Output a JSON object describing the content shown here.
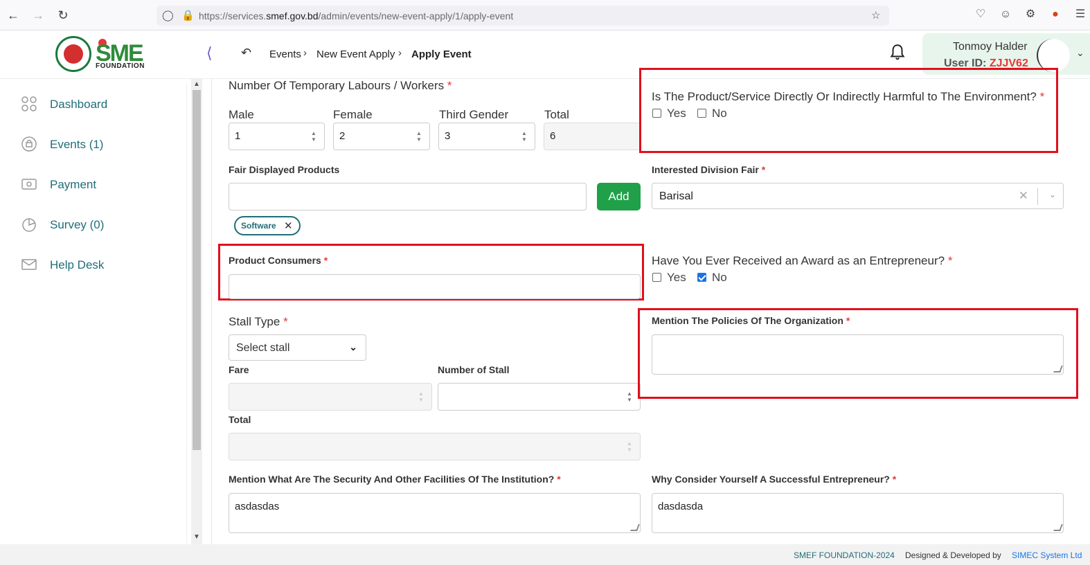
{
  "browser": {
    "url_prefix": "https://services.",
    "url_domain": "smef.gov.bd",
    "url_path": "/admin/events/new-event-apply/1/apply-event"
  },
  "header": {
    "logo_text": "SME",
    "logo_subtext": "FOUNDATION",
    "breadcrumb": [
      "Events",
      "New Event Apply",
      "Apply Event"
    ],
    "user_name": "Tonmoy Halder",
    "user_id_label": "User ID:",
    "user_id": "ZJJV62"
  },
  "sidebar": {
    "items": [
      {
        "label": "Dashboard",
        "icon": "dashboard-icon"
      },
      {
        "label": "Events (1)",
        "icon": "events-icon"
      },
      {
        "label": "Payment",
        "icon": "payment-icon"
      },
      {
        "label": "Survey (0)",
        "icon": "survey-icon"
      },
      {
        "label": "Help Desk",
        "icon": "mail-icon"
      }
    ]
  },
  "form": {
    "labours": {
      "title": "Number Of Temporary Labours / Workers",
      "male_label": "Male",
      "male_value": "1",
      "female_label": "Female",
      "female_value": "2",
      "third_label": "Third Gender",
      "third_value": "3",
      "total_label": "Total",
      "total_value": "6"
    },
    "harmful": {
      "question": "Is The Product/Service Directly Or Indirectly Harmful to The Environment?",
      "yes": "Yes",
      "no": "No",
      "yes_checked": false,
      "no_checked": false
    },
    "fair_products": {
      "label": "Fair Displayed Products",
      "value": "",
      "add_button": "Add",
      "tags": [
        "Software"
      ]
    },
    "division": {
      "label": "Interested Division Fair",
      "value": "Barisal"
    },
    "consumers": {
      "label": "Product Consumers",
      "value": ""
    },
    "award": {
      "question": "Have You Ever Received an Award as an Entrepreneur?",
      "yes": "Yes",
      "no": "No",
      "yes_checked": false,
      "no_checked": true
    },
    "stall": {
      "label": "Stall Type",
      "placeholder": "Select stall",
      "fare_label": "Fare",
      "number_label": "Number of Stall",
      "total_label": "Total"
    },
    "policies": {
      "label": "Mention The Policies Of The Organization",
      "value": ""
    },
    "security": {
      "label": "Mention What Are The Security And Other Facilities Of The Institution?",
      "value": "asdasdas"
    },
    "successful": {
      "label": "Why Consider Yourself A Successful Entrepreneur?",
      "value": "dasdasda"
    }
  },
  "footer": {
    "copyright": "SMEF FOUNDATION-2024",
    "designed_by": "Designed & Developed by",
    "company": "SIMEC System Ltd"
  },
  "colors": {
    "accent": "#1f6d78",
    "add_button": "#1fa049",
    "required": "#e53935",
    "highlight_box": "#e0101c"
  }
}
